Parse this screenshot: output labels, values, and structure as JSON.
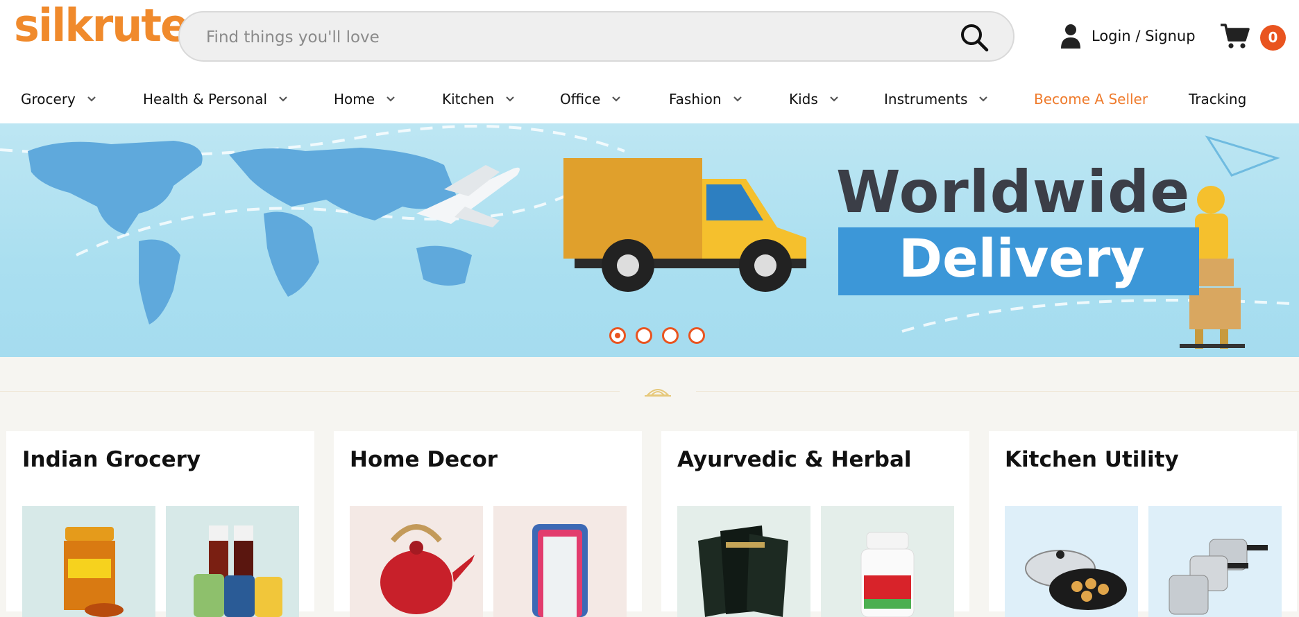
{
  "header": {
    "logo_text": "silkrute",
    "search_placeholder": "Find things you'll love",
    "login_label": "Login / Signup",
    "cart_count": "0"
  },
  "nav": {
    "items": [
      {
        "label": "Grocery",
        "dropdown": true
      },
      {
        "label": "Health & Personal",
        "dropdown": true
      },
      {
        "label": "Home",
        "dropdown": true
      },
      {
        "label": "Kitchen",
        "dropdown": true
      },
      {
        "label": "Office",
        "dropdown": true
      },
      {
        "label": "Fashion",
        "dropdown": true
      },
      {
        "label": "Kids",
        "dropdown": true
      },
      {
        "label": "Instruments",
        "dropdown": true
      },
      {
        "label": "Become A Seller",
        "dropdown": false
      },
      {
        "label": "Tracking",
        "dropdown": false
      }
    ]
  },
  "banner": {
    "headline_line1": "Worldwide",
    "headline_line2": "Delivery",
    "slide_count": 4,
    "active_slide": 1
  },
  "categories": [
    {
      "title": "Indian Grocery",
      "images": [
        "honey-jar-image",
        "sauce-bottles-image"
      ]
    },
    {
      "title": "Home Decor",
      "images": [
        "kettle-image",
        "mirror-image"
      ]
    },
    {
      "title": "Ayurvedic & Herbal",
      "images": [
        "green-tea-image",
        "supplement-bottle-image"
      ]
    },
    {
      "title": "Kitchen Utility",
      "images": [
        "appam-pan-image",
        "pressure-cooker-image"
      ]
    }
  ],
  "colors": {
    "brand_orange": "#f08a2c",
    "accent_red": "#e9541f",
    "banner_blue": "#aadff0"
  }
}
